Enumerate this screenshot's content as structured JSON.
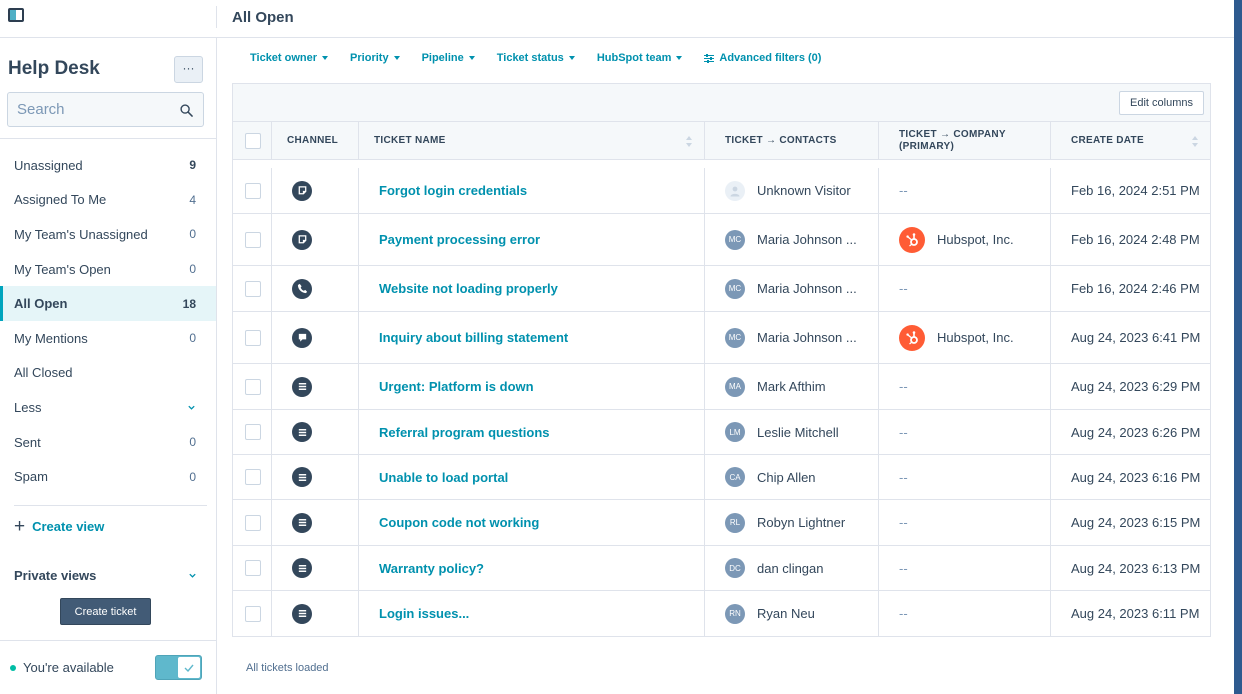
{
  "header": {
    "title": "All Open"
  },
  "sidebar": {
    "title": "Help Desk",
    "more_label": "···",
    "search_placeholder": "Search",
    "items": [
      {
        "label": "Unassigned",
        "count": "9",
        "bold": true
      },
      {
        "label": "Assigned To Me",
        "count": "4"
      },
      {
        "label": "My Team's Unassigned",
        "count": "0"
      },
      {
        "label": "My Team's Open",
        "count": "0"
      },
      {
        "label": "All Open",
        "count": "18",
        "active": true
      },
      {
        "label": "My Mentions",
        "count": "0"
      },
      {
        "label": "All Closed",
        "count": ""
      },
      {
        "label": "Less",
        "count": ""
      },
      {
        "label": "Sent",
        "count": "0"
      },
      {
        "label": "Spam",
        "count": "0"
      }
    ],
    "create_view_label": "Create view",
    "private_views_label": "Private views",
    "create_ticket_label": "Create ticket",
    "availability_label": "You're available",
    "availability_on": true
  },
  "filters": [
    {
      "label": "Ticket owner",
      "has_caret": true
    },
    {
      "label": "Priority",
      "has_caret": true
    },
    {
      "label": "Pipeline",
      "has_caret": true
    },
    {
      "label": "Ticket status",
      "has_caret": true
    },
    {
      "label": "HubSpot team",
      "has_caret": true
    },
    {
      "label": "Advanced filters (0)",
      "has_caret": false
    }
  ],
  "table": {
    "edit_columns_label": "Edit columns",
    "columns": [
      "CHANNEL",
      "TICKET NAME",
      "TICKET → CONTACTS",
      "TICKET → COMPANY (PRIMARY)",
      "CREATE DATE"
    ],
    "rows": [
      {
        "channel": "form-icon",
        "name": "Forgot login credentials",
        "contact_initials": "",
        "contact": "Unknown Visitor",
        "company": "--",
        "date": "Feb 16, 2024 2:51 PM"
      },
      {
        "channel": "form-icon",
        "name": "Payment processing error",
        "contact_initials": "MC",
        "contact": "Maria Johnson ...",
        "company": "Hubspot, Inc.",
        "date": "Feb 16, 2024 2:48 PM"
      },
      {
        "channel": "phone-icon",
        "name": "Website not loading properly",
        "contact_initials": "MC",
        "contact": "Maria Johnson ...",
        "company": "--",
        "date": "Feb 16, 2024 2:46 PM"
      },
      {
        "channel": "chat-icon",
        "name": "Inquiry about billing statement",
        "contact_initials": "MC",
        "contact": "Maria Johnson ...",
        "company": "Hubspot, Inc.",
        "date": "Aug 24, 2023 6:41 PM"
      },
      {
        "channel": "list-icon",
        "name": "Urgent: Platform is down",
        "contact_initials": "MA",
        "contact": "Mark Afthim",
        "company": "--",
        "date": "Aug 24, 2023 6:29 PM"
      },
      {
        "channel": "list-icon",
        "name": "Referral program questions",
        "contact_initials": "LM",
        "contact": "Leslie Mitchell",
        "company": "--",
        "date": "Aug 24, 2023 6:26 PM"
      },
      {
        "channel": "list-icon",
        "name": "Unable to load portal",
        "contact_initials": "CA",
        "contact": "Chip Allen",
        "company": "--",
        "date": "Aug 24, 2023 6:16 PM"
      },
      {
        "channel": "list-icon",
        "name": "Coupon code not working",
        "contact_initials": "RL",
        "contact": "Robyn Lightner",
        "company": "--",
        "date": "Aug 24, 2023 6:15 PM"
      },
      {
        "channel": "list-icon",
        "name": "Warranty policy?",
        "contact_initials": "DC",
        "contact": "dan clingan",
        "company": "--",
        "date": "Aug 24, 2023 6:13 PM"
      },
      {
        "channel": "list-icon",
        "name": "Login issues...",
        "contact_initials": "RN",
        "contact": "Ryan Neu",
        "company": "--",
        "date": "Aug 24, 2023 6:11 PM"
      }
    ],
    "status_text": "All tickets loaded"
  },
  "colors": {
    "accent": "#0091ae",
    "active_bg": "#e5f5f8",
    "brand_orange": "#ff5c35",
    "text": "#33475b"
  }
}
